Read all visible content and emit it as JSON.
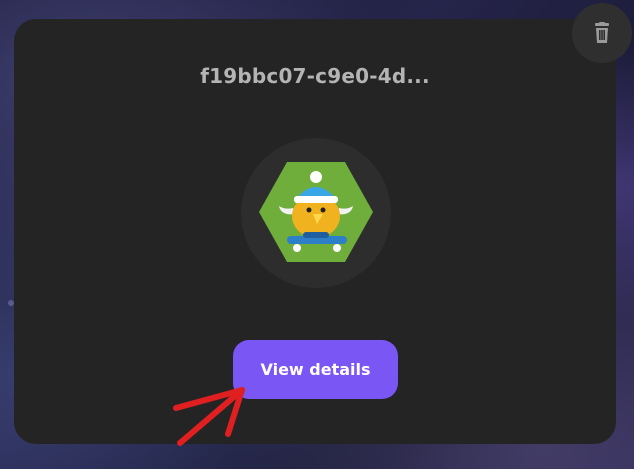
{
  "card": {
    "title": "f19bbc07-c9e0-4d...",
    "view_button_label": "View details"
  },
  "icons": {
    "delete": "trash-icon",
    "avatar": "bird-skater-avatar",
    "annotation": "red-arrow"
  },
  "colors": {
    "card_bg": "#242424",
    "primary_button": "#7a56f5",
    "annotation_arrow": "#e02020"
  }
}
